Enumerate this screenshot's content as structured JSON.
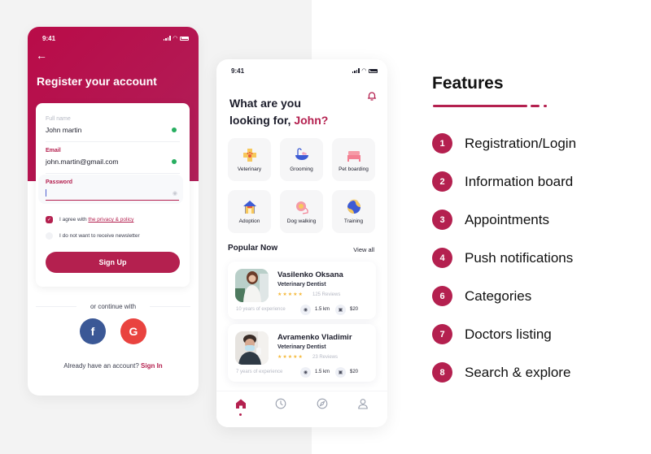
{
  "colors": {
    "accent": "#b4204f",
    "left_bg": "#f3f3f3"
  },
  "register_screen": {
    "status_time": "9:41",
    "back_icon": "arrow-left-icon",
    "title": "Register your account",
    "fields": [
      {
        "label": "Full name",
        "value": "John martin",
        "valid": true
      },
      {
        "label": "Email",
        "value": "john.martin@gmail.com",
        "valid": true
      },
      {
        "label": "Password",
        "value": "",
        "icon": "eye-icon"
      }
    ],
    "agree_prefix": "I agree with ",
    "agree_link": "the privacy & policy",
    "agree_checked": true,
    "newsletter_label": "I do not want to receive newsletter",
    "newsletter_checked": false,
    "signup_label": "Sign Up",
    "or_continue": "or continue with",
    "facebook_glyph": "f",
    "google_glyph": "G",
    "have_account": "Already have an account?",
    "signin_label": "Sign In"
  },
  "home_screen": {
    "status_time": "9:41",
    "greeting_line1": "What are you",
    "greeting_line2": "looking for,",
    "user_name": "John?",
    "categories": [
      {
        "label": "Veterinary",
        "icon": "veterinary-icon"
      },
      {
        "label": "Grooming",
        "icon": "bathtub-icon"
      },
      {
        "label": "Pet boarding",
        "icon": "bed-icon"
      },
      {
        "label": "Adoption",
        "icon": "house-icon"
      },
      {
        "label": "Dog walking",
        "icon": "leash-icon"
      },
      {
        "label": "Training",
        "icon": "ball-icon"
      }
    ],
    "popular_title": "Popular Now",
    "view_all": "View all",
    "doctors": [
      {
        "name": "Vasilenko Oksana",
        "role": "Veterinary Dentist",
        "rating": 4.5,
        "stars": "★★★★★",
        "reviews": "125 Reviews",
        "experience": "10 years of experience",
        "distance": "1.5 km",
        "price": "$20"
      },
      {
        "name": "Avramenko Vladimir",
        "role": "Veterinary Dentist",
        "rating": 4.5,
        "stars": "★★★★★",
        "reviews": "23 Reviews",
        "experience": "7 years of experience",
        "distance": "1.5 km",
        "price": "$20"
      }
    ],
    "tabs": [
      "home",
      "history",
      "explore",
      "profile"
    ],
    "active_tab": "home"
  },
  "features": {
    "title": "Features",
    "items": [
      {
        "num": "1",
        "label": "Registration/Login"
      },
      {
        "num": "2",
        "label": "Information board"
      },
      {
        "num": "3",
        "label": "Appointments"
      },
      {
        "num": "4",
        "label": "Push notifications"
      },
      {
        "num": "6",
        "label": "Categories"
      },
      {
        "num": "7",
        "label": "Doctors listing"
      },
      {
        "num": "8",
        "label": "Search & explore"
      }
    ]
  }
}
